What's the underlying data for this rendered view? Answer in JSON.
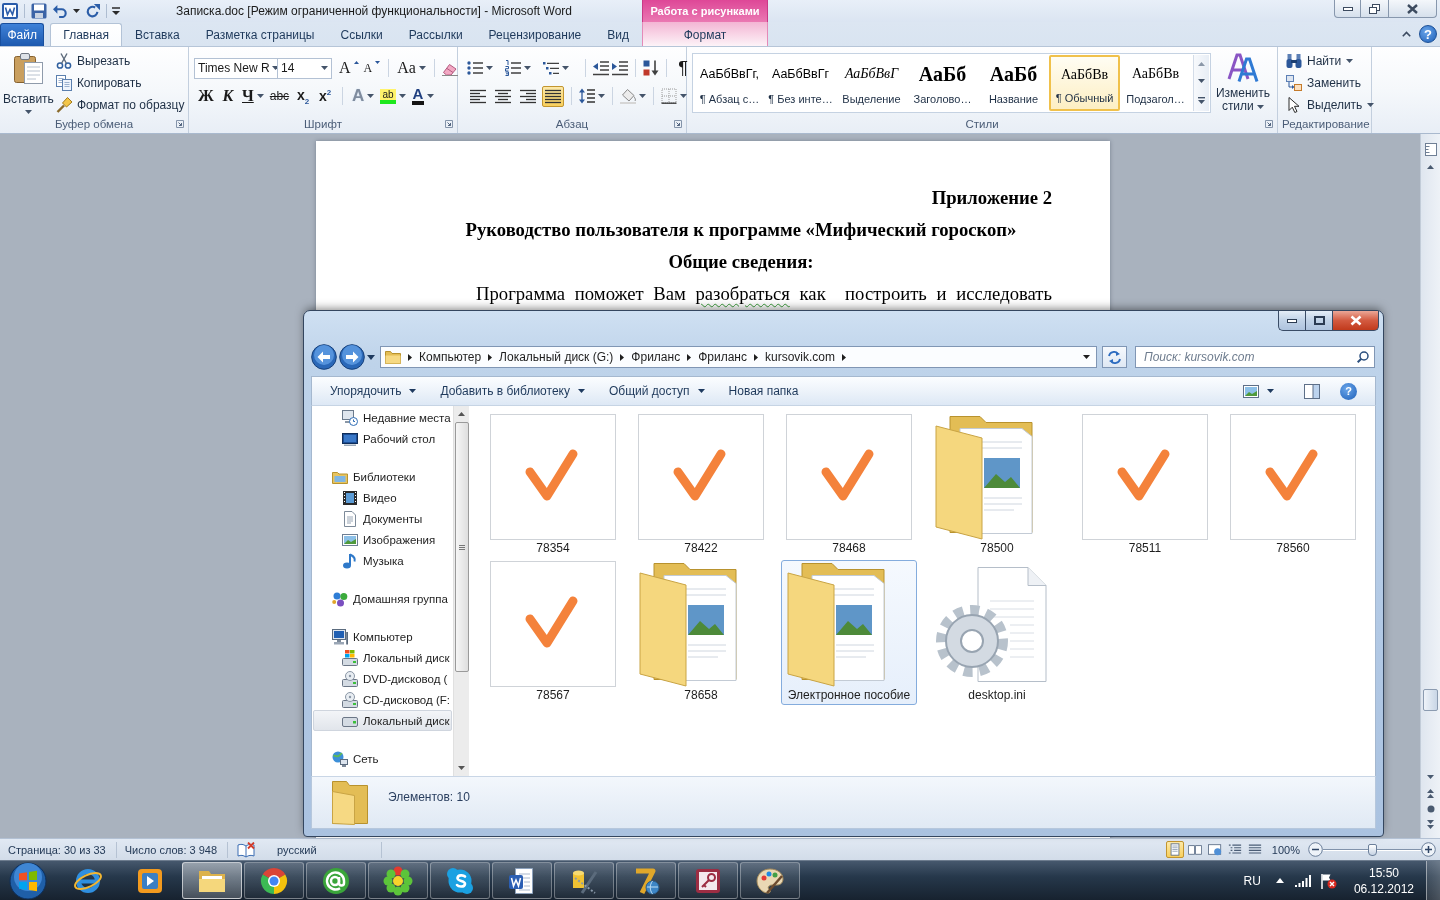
{
  "word": {
    "title_bar": {
      "title": "Записка.doc [Режим ограниченной функциональности] - Microsoft Word",
      "context_group": "Работа с рисунками"
    },
    "tabs": [
      {
        "label": "Файл",
        "kind": "file",
        "selected": false
      },
      {
        "label": "Главная",
        "kind": "normal",
        "selected": true
      },
      {
        "label": "Вставка",
        "kind": "normal",
        "selected": false
      },
      {
        "label": "Разметка страницы",
        "kind": "normal",
        "selected": false
      },
      {
        "label": "Ссылки",
        "kind": "normal",
        "selected": false
      },
      {
        "label": "Рассылки",
        "kind": "normal",
        "selected": false
      },
      {
        "label": "Рецензирование",
        "kind": "normal",
        "selected": false
      },
      {
        "label": "Вид",
        "kind": "normal",
        "selected": false
      },
      {
        "label": "Формат",
        "kind": "context",
        "selected": false
      }
    ],
    "help": "?",
    "ribbon": {
      "clipboard": {
        "title": "Буфер обмена",
        "paste": "Вставить",
        "commands": [
          {
            "kind": "cut",
            "label": "Вырезать"
          },
          {
            "kind": "copy",
            "label": "Копировать"
          },
          {
            "kind": "format_painter",
            "label": "Формат по образцу"
          }
        ]
      },
      "font": {
        "title": "Шрифт",
        "font_name": "Times New R",
        "font_size": "14",
        "row1": [
          {
            "kind": "grow",
            "label": "A"
          },
          {
            "kind": "shrink",
            "label": "A"
          },
          {
            "kind": "change_case",
            "label": "Aa"
          },
          {
            "kind": "clear"
          }
        ],
        "row2": [
          {
            "kind": "bold",
            "label": "Ж",
            "disabled": false
          },
          {
            "kind": "italic",
            "label": "К",
            "disabled": false
          },
          {
            "kind": "underline",
            "label": "Ч",
            "disabled": false
          },
          {
            "kind": "strike",
            "label": "abc",
            "disabled": false
          },
          {
            "kind": "subscript",
            "label": "x$_{2}$",
            "disabled": false
          },
          {
            "kind": "superscript",
            "label": "x$^{2}$",
            "disabled": false
          },
          {
            "kind": "effects",
            "label": "A",
            "disabled": true
          },
          {
            "kind": "highlight",
            "label": "ab",
            "disabled": false
          },
          {
            "kind": "font_color",
            "label": "A",
            "disabled": false
          }
        ]
      },
      "paragraph": {
        "title": "Абзац",
        "row1": [
          {
            "kind": "bullets"
          },
          {
            "kind": "numbering"
          },
          {
            "kind": "multilevel"
          },
          {
            "kind": "outdent"
          },
          {
            "kind": "indent"
          },
          {
            "kind": "sort"
          },
          {
            "kind": "pilcrow",
            "label": "¶"
          }
        ],
        "alignment": [
          {
            "kind": "left",
            "selected": false
          },
          {
            "kind": "center",
            "selected": false
          },
          {
            "kind": "right",
            "selected": false
          },
          {
            "kind": "justify",
            "selected": true
          }
        ],
        "tools": [
          {
            "kind": "line_spacing"
          },
          {
            "kind": "shading"
          },
          {
            "kind": "borders"
          }
        ]
      },
      "styles": {
        "title": "Стили",
        "gallery": [
          {
            "preview": "АаБбВвГг,",
            "name": "¶ Абзац с…",
            "kind": "plain",
            "selected": false
          },
          {
            "preview": "АаБбВвГг",
            "name": "¶ Без инте…",
            "kind": "plain",
            "selected": false
          },
          {
            "preview": "АаБбВвГ",
            "name": "Выделение",
            "kind": "emphasis",
            "selected": false
          },
          {
            "preview": "АаБб",
            "name": "Заголово…",
            "kind": "heading",
            "selected": false
          },
          {
            "preview": "АаБб",
            "name": "Название",
            "kind": "heading",
            "selected": false
          },
          {
            "preview": "АаБбВв",
            "name": "¶ Обычный",
            "kind": "normal",
            "selected": true
          },
          {
            "preview": "АаБбВв",
            "name": "Подзагол…",
            "kind": "normal",
            "selected": false
          }
        ],
        "change_styles": "Изменить стили"
      },
      "editing": {
        "title": "Редактирование",
        "commands": [
          {
            "kind": "find",
            "label": "Найти",
            "dropdown": true
          },
          {
            "kind": "replace",
            "label": "Заменить",
            "dropdown": false
          },
          {
            "kind": "select",
            "label": "Выделить",
            "dropdown": true
          }
        ]
      }
    },
    "document": {
      "blocks": [
        {
          "kind": "label",
          "text": "Приложение 2"
        },
        {
          "kind": "title",
          "text": "Руководство пользователя к программе «Мифический гороскоп»"
        },
        {
          "kind": "section",
          "text": "Общие сведения:"
        },
        {
          "kind": "paragraph",
          "segments": [
            {
              "text": "Программа поможет Вам ",
              "flagged": false
            },
            {
              "text": "разобраться",
              "flagged": true
            },
            {
              "text": " как  построить и исследовать",
              "flagged": false
            }
          ]
        }
      ]
    },
    "status_bar": {
      "page": "Страница: 30 из 33",
      "words": "Число слов: 3 948",
      "language": "русский",
      "views": [
        {
          "kind": "print",
          "selected": true
        },
        {
          "kind": "reading",
          "selected": false
        },
        {
          "kind": "web",
          "selected": false
        },
        {
          "kind": "outline",
          "selected": false
        },
        {
          "kind": "draft",
          "selected": false
        }
      ],
      "zoom": "100%",
      "zoom_slider": {
        "level": 0.5
      }
    }
  },
  "explorer": {
    "address": [
      "Компьютер",
      "Локальный диск (G:)",
      "Фриланс",
      "Фриланс",
      "kursovik.com"
    ],
    "search": {
      "placeholder": "Поиск: kursovik.com"
    },
    "toolbar": [
      {
        "label": "Упорядочить",
        "dropdown": true
      },
      {
        "label": "Добавить в библиотеку",
        "dropdown": true
      },
      {
        "label": "Общий доступ",
        "dropdown": true
      },
      {
        "label": "Новая папка",
        "dropdown": false
      }
    ],
    "help": "?",
    "nav": [
      {
        "children": [
          {
            "label": "Недавние места",
            "kind": "recent",
            "selected": false
          },
          {
            "label": "Рабочий стол",
            "kind": "desktop",
            "selected": false
          }
        ]
      },
      {
        "label": "Библиотеки",
        "kind": "library",
        "selected": false,
        "children": [
          {
            "label": "Видео",
            "kind": "video",
            "selected": false
          },
          {
            "label": "Документы",
            "kind": "documents",
            "selected": false
          },
          {
            "label": "Изображения",
            "kind": "pictures",
            "selected": false
          },
          {
            "label": "Музыка",
            "kind": "music",
            "selected": false
          }
        ]
      },
      {
        "label": "Домашняя группа",
        "kind": "homegroup",
        "selected": false
      },
      {
        "label": "Компьютер",
        "kind": "computer",
        "selected": false,
        "children": [
          {
            "label": "Локальный диск",
            "kind": "system_drive",
            "selected": false
          },
          {
            "label": "DVD-дисковод (",
            "kind": "optical_drive",
            "selected": false
          },
          {
            "label": "CD-дисковод (F:",
            "kind": "optical_drive",
            "selected": false
          },
          {
            "label": "Локальный диск",
            "kind": "drive",
            "selected": true
          }
        ]
      },
      {
        "label": "Сеть",
        "kind": "network",
        "selected": false
      }
    ],
    "files": [
      {
        "name": "78354",
        "kind": "image",
        "selected": false
      },
      {
        "name": "78422",
        "kind": "image",
        "selected": false
      },
      {
        "name": "78468",
        "kind": "image",
        "selected": false
      },
      {
        "name": "78500",
        "kind": "folder",
        "selected": false
      },
      {
        "name": "78511",
        "kind": "image",
        "selected": false
      },
      {
        "name": "78560",
        "kind": "image",
        "selected": false
      },
      {
        "name": "78567",
        "kind": "image",
        "selected": false
      },
      {
        "name": "78658",
        "kind": "folder",
        "selected": false
      },
      {
        "name": "Электронное пособие",
        "kind": "folder",
        "selected": true
      },
      {
        "name": "desktop.ini",
        "kind": "settings_file",
        "selected": false
      }
    ],
    "status": "Элементов: 10"
  },
  "taskbar": {
    "buttons": [
      {
        "running": false,
        "active": false
      },
      {
        "running": false,
        "active": false
      },
      {
        "running": true,
        "active": true
      },
      {
        "running": true,
        "active": false
      },
      {
        "running": true,
        "active": false
      },
      {
        "running": true,
        "active": false
      },
      {
        "running": true,
        "active": false
      },
      {
        "running": true,
        "active": false
      },
      {
        "running": true,
        "active": false
      },
      {
        "running": true,
        "active": false
      },
      {
        "running": true,
        "active": false
      },
      {
        "running": true,
        "active": false
      }
    ],
    "language": "RU",
    "time": "15:50",
    "date": "06.12.2012"
  }
}
